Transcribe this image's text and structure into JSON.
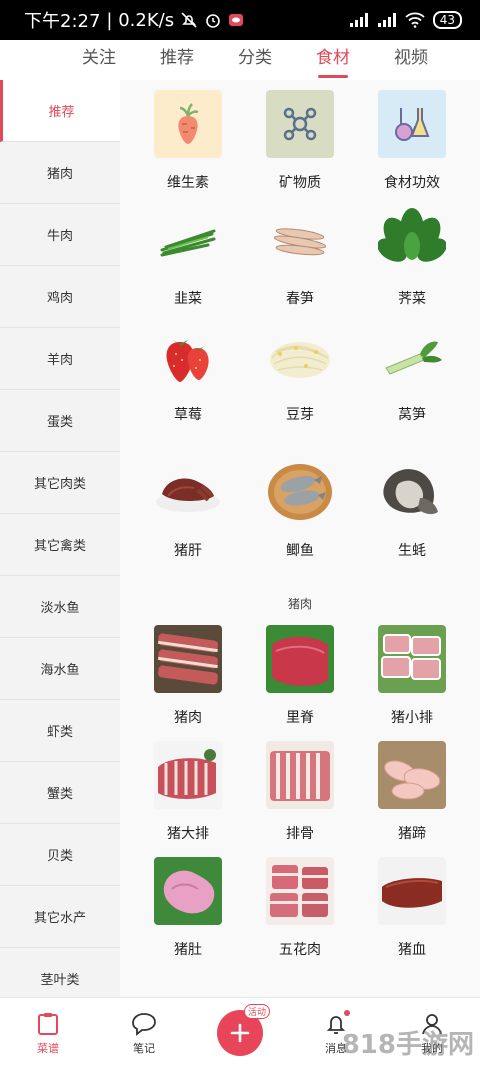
{
  "status_bar": {
    "time": "下午2:27",
    "speed": "| 0.2K/s",
    "battery": "43"
  },
  "top_tabs": [
    {
      "label": "关注"
    },
    {
      "label": "推荐"
    },
    {
      "label": "分类"
    },
    {
      "label": "食材",
      "active": true
    },
    {
      "label": "视频"
    }
  ],
  "sidebar": {
    "items": [
      {
        "label": "推荐",
        "active": true
      },
      {
        "label": "猪肉"
      },
      {
        "label": "牛肉"
      },
      {
        "label": "鸡肉"
      },
      {
        "label": "羊肉"
      },
      {
        "label": "蛋类"
      },
      {
        "label": "其它肉类"
      },
      {
        "label": "其它禽类"
      },
      {
        "label": "淡水鱼"
      },
      {
        "label": "海水鱼"
      },
      {
        "label": "虾类"
      },
      {
        "label": "蟹类"
      },
      {
        "label": "贝类"
      },
      {
        "label": "其它水产"
      },
      {
        "label": "茎叶类"
      }
    ]
  },
  "recommend_grid": [
    {
      "label": "维生素",
      "icon": "carrot-icon"
    },
    {
      "label": "矿物质",
      "icon": "molecule-icon"
    },
    {
      "label": "食材功效",
      "icon": "flask-icon"
    },
    {
      "label": "韭菜",
      "icon": "chives-image"
    },
    {
      "label": "春笋",
      "icon": "bamboo-shoot-image"
    },
    {
      "label": "荠菜",
      "icon": "shepherds-purse-image"
    },
    {
      "label": "草莓",
      "icon": "strawberry-image"
    },
    {
      "label": "豆芽",
      "icon": "bean-sprout-image"
    },
    {
      "label": "莴笋",
      "icon": "lettuce-stem-image"
    },
    {
      "label": "猪肝",
      "icon": "pork-liver-image"
    },
    {
      "label": "鲫鱼",
      "icon": "crucian-carp-image"
    },
    {
      "label": "生蚝",
      "icon": "oyster-image"
    }
  ],
  "pork_section": {
    "title": "猪肉",
    "items": [
      {
        "label": "猪肉",
        "icon": "pork-image"
      },
      {
        "label": "里脊",
        "icon": "tenderloin-image"
      },
      {
        "label": "猪小排",
        "icon": "pork-ribs-small-image"
      },
      {
        "label": "猪大排",
        "icon": "pork-chop-image"
      },
      {
        "label": "排骨",
        "icon": "spare-ribs-image"
      },
      {
        "label": "猪蹄",
        "icon": "pig-trotter-image"
      },
      {
        "label": "猪肚",
        "icon": "pork-tripe-image"
      },
      {
        "label": "五花肉",
        "icon": "pork-belly-image"
      },
      {
        "label": "猪血",
        "icon": "pig-blood-image"
      }
    ]
  },
  "bottom_nav": [
    {
      "label": "菜谱",
      "active": true
    },
    {
      "label": "笔记"
    },
    {
      "label": "",
      "badge": "活动"
    },
    {
      "label": "消息"
    },
    {
      "label": "我的"
    }
  ],
  "watermark": "818手游网",
  "colors": {
    "accent": "#e04a5a",
    "sidebar_bg": "#f3f3f3",
    "content_bg": "#f9f9f9"
  }
}
